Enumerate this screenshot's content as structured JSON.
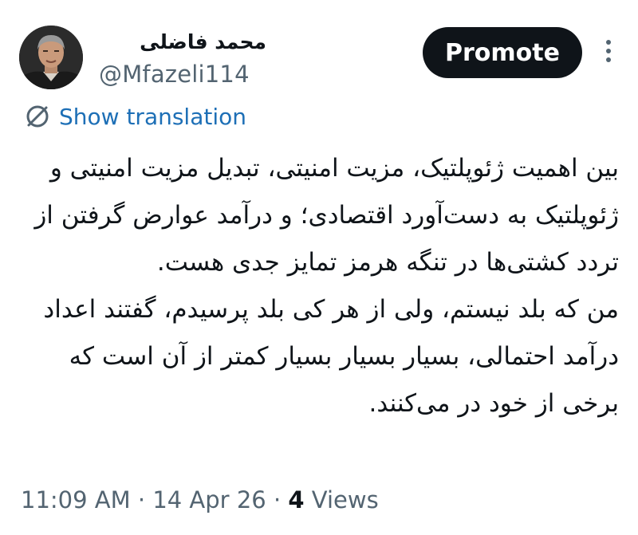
{
  "author": {
    "display_name": "محمد فاضلی",
    "handle": "@Mfazeli114"
  },
  "actions": {
    "promote_label": "Promote",
    "more_icon": "more-horizontal-icon"
  },
  "translation": {
    "icon": "translate-icon",
    "label": "Show translation"
  },
  "body": {
    "paragraph_1": "بین اهمیت ژئوپلتیک، مزیت امنیتی، تبدیل مزیت امنیتی و ژئوپلتیک به دست‌آورد اقتصادی؛ و درآمد عوارض گرفتن از تردد کشتی‌ها در تنگه هرمز تمایز جدی هست.",
    "paragraph_2": "من که بلد نیستم، ولی از هر کی بلد پرسیدم، گفتند اعداد درآمد احتمالی، بسیار بسیار بسیار کمتر از آن است که برخی از خود در می‌کنند."
  },
  "meta": {
    "time": "11:09 AM",
    "separator": "·",
    "date": "14 Apr 26",
    "views_count": "4",
    "views_label": "Views"
  },
  "colors": {
    "text": "#0f1419",
    "secondary": "#536471",
    "link": "#1d6fb6",
    "button_bg": "#0f1419"
  }
}
